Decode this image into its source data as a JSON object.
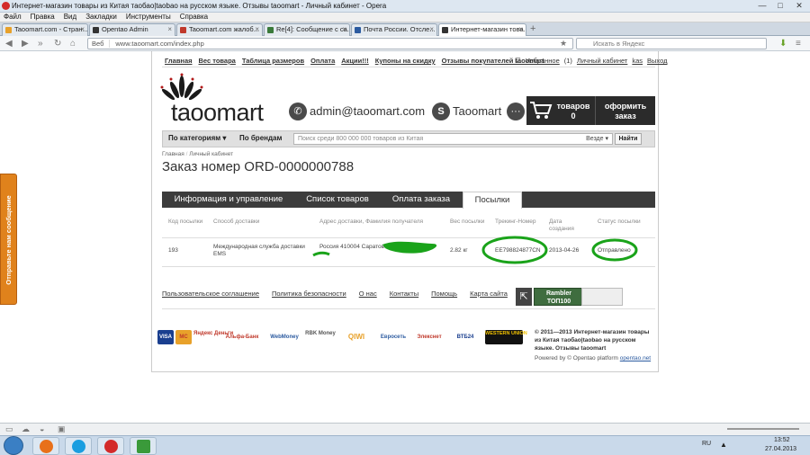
{
  "browser": {
    "window_title": "Интернет-магазин товары из Китая таобао|taobao на русском языке. Отзывы taoomart - Личный кабинет - Opera",
    "menu": [
      "Файл",
      "Правка",
      "Вид",
      "Закладки",
      "Инструменты",
      "Справка"
    ],
    "tabs": [
      {
        "label": "Taoomart.com - Стран...",
        "color": "#e8a12a"
      },
      {
        "label": "Opentao Admin",
        "color": "#333333"
      },
      {
        "label": "Taoomart.com жалоб...",
        "color": "#c0392b"
      },
      {
        "label": "Re[4]: Сообщение с са...",
        "color": "#3a7a3a"
      },
      {
        "label": "Почта России. Отсле...",
        "color": "#2c5ba0"
      },
      {
        "label": "Интернет-магазин това...",
        "color": "#333333"
      }
    ],
    "address_prefix": "Веб",
    "url": "www.taoomart.com/index.php",
    "search_placeholder": "Искать в Яндекс"
  },
  "feedback_tab": "Отправьте нам сообщение",
  "site": {
    "top_links": [
      "Главная",
      "Вес товара",
      "Таблица размеров",
      "Оплата",
      "Акции!!!",
      "Купоны на скидку",
      "Отзывы покупателей taoomart"
    ],
    "favorites": "Избранное",
    "favorites_count": "(1)",
    "cabinet": "Личный кабинет",
    "user": "kas",
    "logout": "Выход",
    "logo": "taoomart",
    "email": "admin@taoomart.com",
    "skype": "Taoomart",
    "cart_label": "товаров",
    "cart_count": "0",
    "order_btn": "оформить заказ",
    "categories": "По категориям ▾",
    "brands": "По брендам",
    "search_placeholder": "Поиск среди 800 000 000 товаров из Китая",
    "search_scope": "Везде ▾",
    "search_btn": "Найти"
  },
  "breadcrumb": [
    "Главная",
    "Личный кабинет"
  ],
  "order_title": "Заказ номер ORD-0000000788",
  "order_tabs": [
    "Информация и управление",
    "Список товаров",
    "Оплата заказа",
    "Посылки"
  ],
  "parcels_table": {
    "headers": [
      "Код посылки",
      "Способ доставки",
      "Адрес доставки, Фамилия получателя",
      "Вес посылки",
      "Трекинг-Номер",
      "Дата создания",
      "Статус посылки"
    ],
    "row": {
      "code": "193",
      "delivery": "Международная служба доставки EMS",
      "address": "Россия 410004 Саратов",
      "weight": "2.82 кг",
      "tracking": "EE798824877CN",
      "date": "2013-04-26",
      "status": "Отправлено"
    }
  },
  "footer": {
    "links": [
      "Пользовательское соглашение",
      "Политика безопасности",
      "О нас",
      "Контакты",
      "Помощь",
      "Карта сайта"
    ],
    "rambler": "Rambler ТОП100",
    "payments": [
      "VISA",
      "MC",
      "Яндекс Деньги",
      "Альфа-Банк",
      "WebMoney",
      "RBK Money",
      "QIWI",
      "Евросеть",
      "Элекснет",
      "ВТБ24",
      "WESTERN UNION"
    ],
    "copyright": "© 2011—2013 Интернет-магазин товары из Китая таобао|taobao на русском языке. Отзывы taoomart",
    "powered_prefix": "Powered by © Opentao platform",
    "powered_link": "opentao.net"
  },
  "taskbar": {
    "lang": "RU",
    "time": "13:52",
    "date": "27.04.2013"
  }
}
